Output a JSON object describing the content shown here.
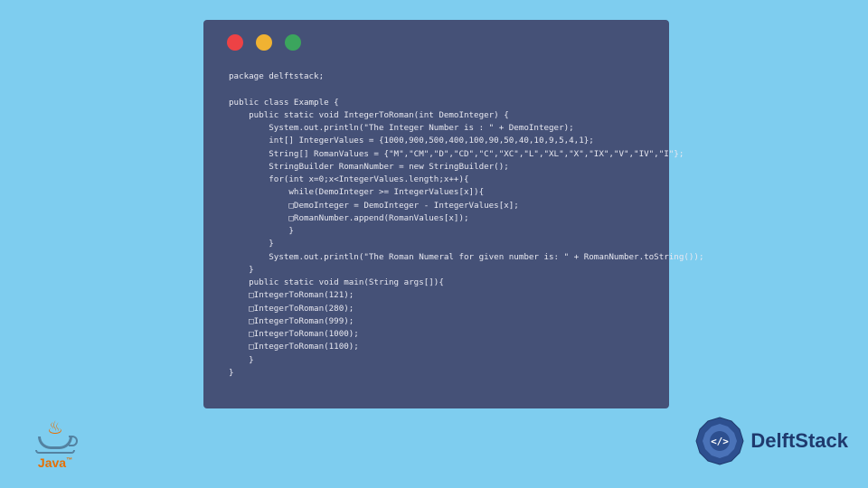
{
  "code": {
    "line1": "package delftstack;",
    "line2": "",
    "line3": "public class Example {",
    "line4": "    public static void IntegerToRoman(int DemoInteger) {",
    "line5": "        System.out.println(\"The Integer Number is : \" + DemoInteger);",
    "line6": "        int[] IntegerValues = {1000,900,500,400,100,90,50,40,10,9,5,4,1};",
    "line7": "        String[] RomanValues = {\"M\",\"CM\",\"D\",\"CD\",\"C\",\"XC\",\"L\",\"XL\",\"X\",\"IX\",\"V\",\"IV\",\"I\"};",
    "line8": "        StringBuilder RomanNumber = new StringBuilder();",
    "line9": "        for(int x=0;x<IntegerValues.length;x++){",
    "line10": "            while(DemoInteger >= IntegerValues[x]){",
    "line11": "            □DemoInteger = DemoInteger - IntegerValues[x];",
    "line12": "            □RomanNumber.append(RomanValues[x]);",
    "line13": "            }",
    "line14": "        }",
    "line15": "        System.out.println(\"The Roman Numeral for given number is: \" + RomanNumber.toString());",
    "line16": "    }",
    "line17": "    public static void main(String args[]){",
    "line18": "    □IntegerToRoman(121);",
    "line19": "    □IntegerToRoman(280);",
    "line20": "    □IntegerToRoman(999);",
    "line21": "    □IntegerToRoman(1000);",
    "line22": "    □IntegerToRoman(1100);",
    "line23": "    }",
    "line24": "}"
  },
  "logos": {
    "java": "Java",
    "delft": "DelftStack"
  },
  "colors": {
    "bg": "#7ecdef",
    "window": "#455177",
    "red": "#ed4245",
    "yellow": "#f0b232",
    "green": "#3ba55d"
  }
}
